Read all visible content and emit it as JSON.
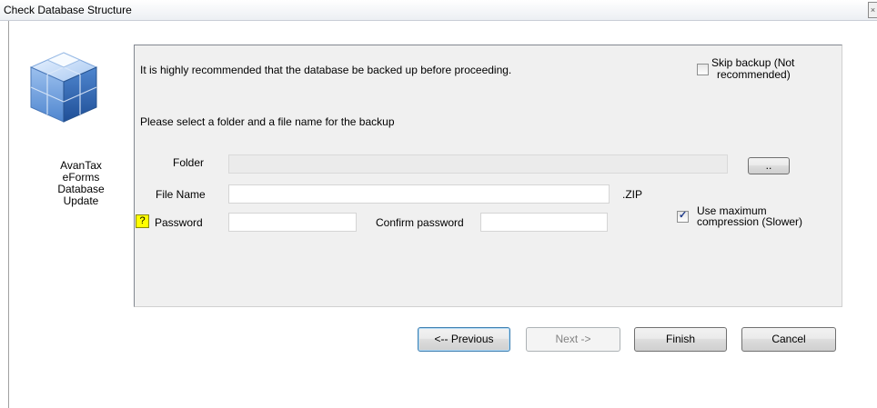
{
  "window": {
    "title": "Check Database Structure",
    "close_glyph": "×"
  },
  "sidebar": {
    "logo_icon": "database-cubes-icon",
    "app_name_lines": [
      "AvanTax",
      "eForms",
      "Database",
      "Update"
    ]
  },
  "panel": {
    "recommendation_text": "It is highly recommended that the database be backed up before proceeding.",
    "skip_backup": {
      "label_line1": "Skip backup (Not",
      "label_line2": "recommended)",
      "checked": false
    },
    "instruction_text": "Please select a folder and a file name for the backup",
    "folder": {
      "label": "Folder",
      "value": "",
      "enabled": false
    },
    "browse_label": "..",
    "file_name": {
      "label": "File Name",
      "value": "",
      "suffix": ".ZIP"
    },
    "password": {
      "help_glyph": "?",
      "label": "Password",
      "value": ""
    },
    "confirm_password": {
      "label": "Confirm password",
      "value": ""
    },
    "max_compression": {
      "label_line1": "Use maximum",
      "label_line2": "compression (Slower)",
      "checked": true
    }
  },
  "buttons": {
    "previous": "<-- Previous",
    "next": "Next ->",
    "next_enabled": false,
    "finish": "Finish",
    "cancel": "Cancel"
  },
  "colors": {
    "panel_bg": "#f0f0f0",
    "help_badge": "#ffff00",
    "logo_blue": "#3d7fd6"
  }
}
